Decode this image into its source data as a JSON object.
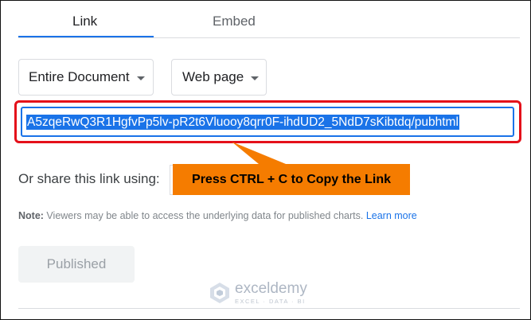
{
  "tabs": {
    "link_label": "Link",
    "embed_label": "Embed"
  },
  "options": {
    "scope_selected": "Entire Document",
    "format_selected": "Web page"
  },
  "url_field": {
    "value": "A5zqeRwQ3R1HgfvPp5lv-pR2t6Vluooy8qrr0F-ihdUD2_5NdD7sKibtdq/pubhtml"
  },
  "share": {
    "label": "Or share this link using:"
  },
  "callout": {
    "text": "Press CTRL + C to Copy the Link"
  },
  "note": {
    "prefix": "Note:",
    "text": " Viewers may be able to access the underlying data for published charts. ",
    "link": "Learn more"
  },
  "published_button": {
    "label": "Published"
  },
  "watermark": {
    "title": "exceldemy",
    "subtitle": "EXCEL · DATA · BI"
  },
  "colors": {
    "accent": "#1a73e8",
    "highlight_border": "#e4101a",
    "callout": "#f57c00"
  }
}
